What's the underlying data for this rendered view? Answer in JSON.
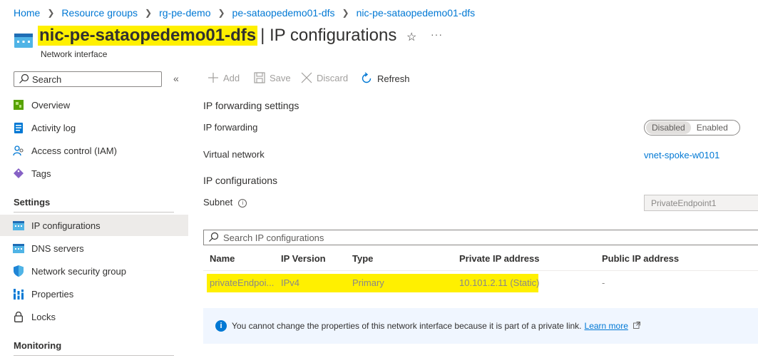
{
  "breadcrumb": {
    "items": [
      "Home",
      "Resource groups",
      "rg-pe-demo",
      "pe-sataopedemo01-dfs",
      "nic-pe-sataopedemo01-dfs"
    ]
  },
  "header": {
    "resource_name": "nic-pe-sataopedemo01-dfs",
    "page_title": "| IP configurations",
    "subtitle": "Network interface",
    "icon": "network-interface-icon",
    "favorite_icon": "star-icon",
    "more_icon": "ellipsis-icon"
  },
  "sidebar": {
    "search_placeholder": "Search",
    "collapse_icon": "double-chevron-left-icon",
    "items": [
      {
        "label": "Overview",
        "icon": "overview-icon"
      },
      {
        "label": "Activity log",
        "icon": "activity-log-icon"
      },
      {
        "label": "Access control (IAM)",
        "icon": "iam-icon"
      },
      {
        "label": "Tags",
        "icon": "tag-icon"
      }
    ],
    "settings_heading": "Settings",
    "settings_items": [
      {
        "label": "IP configurations",
        "icon": "ip-configurations-icon",
        "active": true
      },
      {
        "label": "DNS servers",
        "icon": "dns-servers-icon"
      },
      {
        "label": "Network security group",
        "icon": "shield-icon"
      },
      {
        "label": "Properties",
        "icon": "properties-icon"
      },
      {
        "label": "Locks",
        "icon": "lock-icon"
      }
    ],
    "monitoring_heading": "Monitoring"
  },
  "toolbar": {
    "add_label": "Add",
    "save_label": "Save",
    "discard_label": "Discard",
    "refresh_label": "Refresh"
  },
  "content": {
    "forwarding_heading": "IP forwarding settings",
    "forwarding_label": "IP forwarding",
    "forwarding_toggle": {
      "options": [
        "Disabled",
        "Enabled"
      ],
      "selected": "Disabled"
    },
    "vnet_label": "Virtual network",
    "vnet_value": "vnet-spoke-w0101",
    "ipconfig_heading": "IP configurations",
    "subnet_label": "Subnet",
    "subnet_value": "PrivateEndpoint1",
    "search_placeholder": "Search IP configurations",
    "table": {
      "columns": [
        "Name",
        "IP Version",
        "Type",
        "Private IP address",
        "Public IP address"
      ],
      "rows": [
        {
          "name": "privateEndpoi...",
          "ip_version": "IPv4",
          "type": "Primary",
          "private_ip": "10.101.2.11 (Static)",
          "public_ip": "-"
        }
      ]
    },
    "banner": {
      "text": "You cannot change the properties of this network interface because it is part of a private link.",
      "link": "Learn more"
    }
  },
  "colors": {
    "accent": "#0078d4",
    "highlight": "#fff000",
    "active_nav": "#edebe9",
    "banner_bg": "#f0f6ff"
  }
}
